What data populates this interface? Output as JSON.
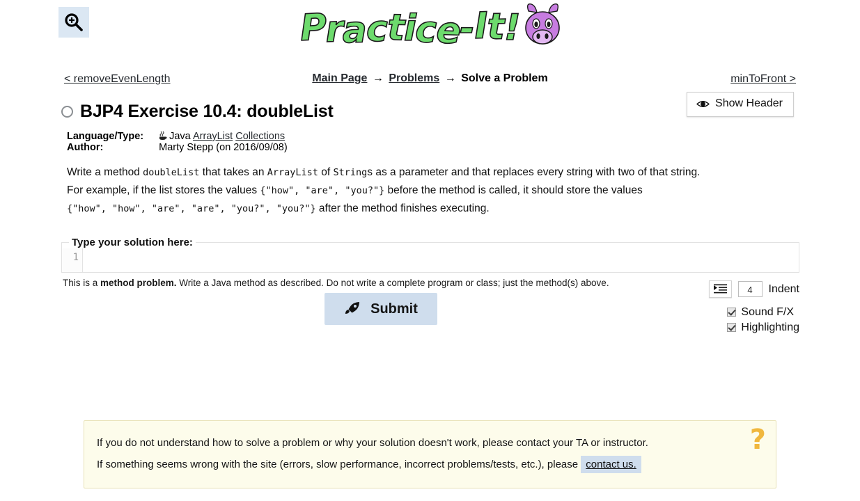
{
  "header": {
    "zoom_icon": "zoom-in-icon",
    "logo_text": "Practice-It!",
    "logo_mascot": "cow-head-icon",
    "logo_color": "#6ddb6d",
    "mascot_color": "#c77ce0"
  },
  "nav": {
    "prev_label": "< removeEvenLength",
    "next_label": "minToFront >",
    "breadcrumb": {
      "main_page": "Main Page",
      "separator": "→",
      "problems": "Problems",
      "current": "Solve a Problem"
    },
    "show_header_label": "Show Header",
    "show_header_icon": "eye-icon"
  },
  "problem": {
    "status_icon": "unsolved-circle-icon",
    "title": "BJP4 Exercise 10.4: doubleList",
    "meta": {
      "language_key": "Language/Type:",
      "language_icon": "java-cup-icon",
      "language_value": "Java",
      "tag_1": "ArrayList",
      "tag_2": "Collections",
      "author_key": "Author:",
      "author_value": "Marty Stepp (on 2016/09/08)"
    },
    "description": {
      "p1_a": "Write a method ",
      "p1_code1": "doubleList",
      "p1_b": " that takes an ",
      "p1_code2": "ArrayList",
      "p1_c": " of ",
      "p1_code3": "String",
      "p1_d": "s as a parameter and that replaces every string with two of that string.",
      "p2_a": "For example, if the list stores the values ",
      "p2_code1": "{\"how\", \"are\", \"you?\"}",
      "p2_b": " before the method is called, it should store the values",
      "p3_code1": "{\"how\", \"how\", \"are\", \"are\", \"you?\", \"you?\"}",
      "p3_a": " after the method finishes executing."
    }
  },
  "editor": {
    "legend": "Type your solution here:",
    "line_number": "1",
    "code_value": "",
    "code_placeholder": ""
  },
  "note": {
    "a": "This is a ",
    "bold": "method problem.",
    "b": " Write a Java method as described. Do not write a complete program or class; just the method(s) above."
  },
  "controls": {
    "indent_icon": "indent-icon",
    "indent_value": "4",
    "indent_label": "Indent",
    "checkboxes": [
      {
        "label": "Sound F/X",
        "checked": true
      },
      {
        "label": "Highlighting",
        "checked": true
      }
    ]
  },
  "submit": {
    "label": "Submit",
    "icon": "rocket-icon",
    "color": "#cfdded"
  },
  "notice": {
    "line1": "If you do not understand how to solve a problem or why your solution doesn't work, please contact your TA or instructor.",
    "line2_a": "If something seems wrong with the site (errors, slow performance, incorrect problems/tests, etc.), please",
    "line2_link": "contact us.",
    "help_icon": "question-mark-icon",
    "help_color": "#f0b73e",
    "background": "#fdfceb"
  }
}
